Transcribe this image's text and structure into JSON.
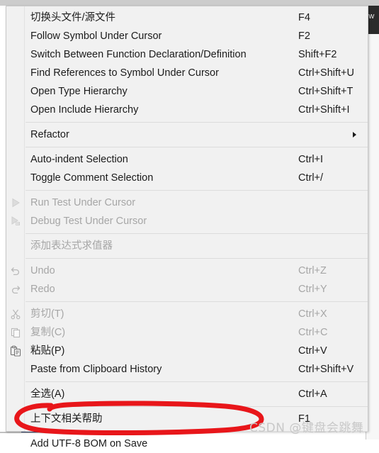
{
  "window": {
    "background_menu_label": "ow",
    "menu_background_color": "#2b2b2b"
  },
  "context_menu": {
    "background_color": "#f1f1f1",
    "border_color": "#c9c9c9",
    "text_color": "#1b1b1b",
    "disabled_text_color": "#a6a6a6",
    "groups": [
      {
        "items": [
          {
            "label": "切换头文件/源文件",
            "shortcut": "F4",
            "disabled": false,
            "icon": "",
            "submenu": false
          },
          {
            "label": "Follow Symbol Under Cursor",
            "shortcut": "F2",
            "disabled": false,
            "icon": "",
            "submenu": false
          },
          {
            "label": "Switch Between Function Declaration/Definition",
            "shortcut": "Shift+F2",
            "disabled": false,
            "icon": "",
            "submenu": false
          },
          {
            "label": "Find References to Symbol Under Cursor",
            "shortcut": "Ctrl+Shift+U",
            "disabled": false,
            "icon": "",
            "submenu": false
          },
          {
            "label": "Open Type Hierarchy",
            "shortcut": "Ctrl+Shift+T",
            "disabled": false,
            "icon": "",
            "submenu": false
          },
          {
            "label": "Open Include Hierarchy",
            "shortcut": "Ctrl+Shift+I",
            "disabled": false,
            "icon": "",
            "submenu": false
          }
        ]
      },
      {
        "items": [
          {
            "label": "Refactor",
            "shortcut": "",
            "disabled": false,
            "icon": "",
            "submenu": true
          }
        ]
      },
      {
        "items": [
          {
            "label": "Auto-indent Selection",
            "shortcut": "Ctrl+I",
            "disabled": false,
            "icon": "",
            "submenu": false
          },
          {
            "label": "Toggle Comment Selection",
            "shortcut": "Ctrl+/",
            "disabled": false,
            "icon": "",
            "submenu": false
          }
        ]
      },
      {
        "items": [
          {
            "label": "Run Test Under Cursor",
            "shortcut": "",
            "disabled": true,
            "icon": "run-icon",
            "submenu": false
          },
          {
            "label": "Debug Test Under Cursor",
            "shortcut": "",
            "disabled": true,
            "icon": "debug-icon",
            "submenu": false
          }
        ]
      },
      {
        "items": [
          {
            "label": "添加表达式求值器",
            "shortcut": "",
            "disabled": true,
            "icon": "",
            "submenu": false
          }
        ]
      },
      {
        "items": [
          {
            "label": "Undo",
            "shortcut": "Ctrl+Z",
            "disabled": true,
            "icon": "undo-icon",
            "submenu": false
          },
          {
            "label": "Redo",
            "shortcut": "Ctrl+Y",
            "disabled": true,
            "icon": "redo-icon",
            "submenu": false
          }
        ]
      },
      {
        "items": [
          {
            "label": "剪切(T)",
            "shortcut": "Ctrl+X",
            "disabled": true,
            "icon": "cut-icon",
            "submenu": false
          },
          {
            "label": "复制(C)",
            "shortcut": "Ctrl+C",
            "disabled": true,
            "icon": "copy-icon",
            "submenu": false
          },
          {
            "label": "粘贴(P)",
            "shortcut": "Ctrl+V",
            "disabled": false,
            "icon": "paste-icon",
            "submenu": false
          },
          {
            "label": "Paste from Clipboard History",
            "shortcut": "Ctrl+Shift+V",
            "disabled": false,
            "icon": "",
            "submenu": false
          }
        ]
      },
      {
        "items": [
          {
            "label": "全选(A)",
            "shortcut": "Ctrl+A",
            "disabled": false,
            "icon": "",
            "submenu": false
          }
        ]
      },
      {
        "items": [
          {
            "label": "上下文相关帮助",
            "shortcut": "F1",
            "disabled": false,
            "icon": "",
            "submenu": false
          }
        ]
      },
      {
        "items": [
          {
            "label": "Add UTF-8 BOM on Save",
            "shortcut": "",
            "disabled": false,
            "icon": "",
            "submenu": false
          }
        ]
      }
    ]
  },
  "annotation": {
    "color": "#e8161a",
    "shape": "hand-drawn-ellipse",
    "target_label": "Add UTF-8 BOM on Save"
  },
  "watermark": {
    "text": "CSDN @键盘会跳舞",
    "color": "#c8c8c8"
  }
}
